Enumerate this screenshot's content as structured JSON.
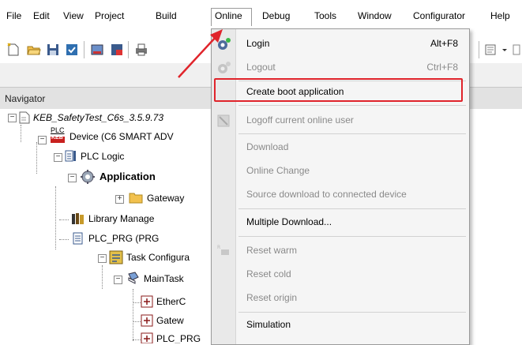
{
  "menubar": {
    "items": [
      "File",
      "Edit",
      "View",
      "Project",
      "Build",
      "Online",
      "Debug",
      "Tools",
      "Window",
      "Configurator",
      "Help"
    ]
  },
  "navigator": {
    "title": "Navigator"
  },
  "tree": {
    "root": "KEB_SafetyTest_C6s_3.5.9.73",
    "device": "Device (C6 SMART ADV",
    "plc_logic": "PLC Logic",
    "application": "Application",
    "gateway": "Gateway",
    "library": "Library Manage",
    "plc_prg": "PLC_PRG (PRG",
    "task_config": "Task Configura",
    "main_task": "MainTask",
    "ether": "EtherC",
    "gatew": "Gatew",
    "plc_prg2": "PLC_PRG",
    "plc_badge": "PLC",
    "keb_badge": "KEB"
  },
  "online_menu": {
    "items": [
      {
        "label": "Login",
        "shortcut": "Alt+F8",
        "enabled": true
      },
      {
        "label": "Logout",
        "shortcut": "Ctrl+F8",
        "enabled": false
      },
      {
        "label": "Create boot application",
        "shortcut": "",
        "enabled": true
      },
      {
        "label": "Logoff current online user",
        "shortcut": "",
        "enabled": false
      },
      {
        "label": "Download",
        "shortcut": "",
        "enabled": false
      },
      {
        "label": "Online Change",
        "shortcut": "",
        "enabled": false
      },
      {
        "label": "Source download to connected device",
        "shortcut": "",
        "enabled": false
      },
      {
        "label": "Multiple Download...",
        "shortcut": "",
        "enabled": true
      },
      {
        "label": "Reset warm",
        "shortcut": "",
        "enabled": false
      },
      {
        "label": "Reset cold",
        "shortcut": "",
        "enabled": false
      },
      {
        "label": "Reset origin",
        "shortcut": "",
        "enabled": false
      },
      {
        "label": "Simulation",
        "shortcut": "",
        "enabled": true
      }
    ]
  },
  "colors": {
    "highlight": "#e0242b",
    "arrow": "#e0242b"
  }
}
